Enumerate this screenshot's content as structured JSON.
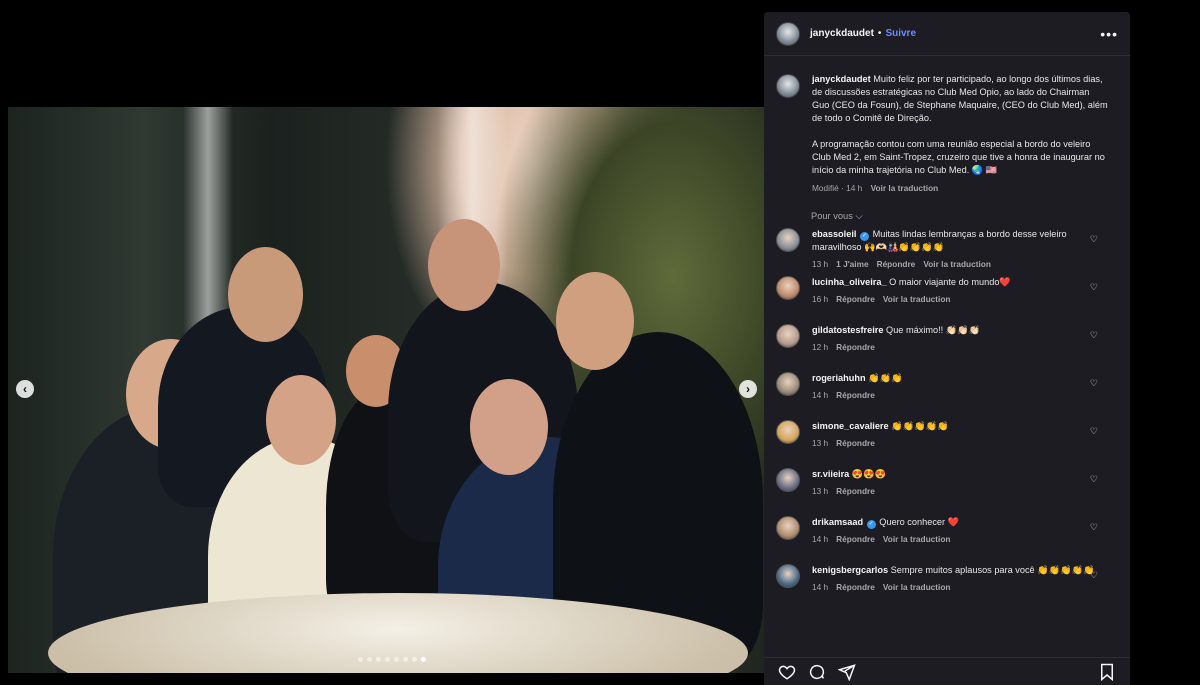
{
  "post": {
    "username": "janyckdaudet",
    "follow_label": "Suivre",
    "separator": "•",
    "more_label": "•••",
    "caption_p1": "Muito feliz por ter participado, ao longo dos últimos dias, de discussões estratégicas no Club Med Opio, ao lado do Chairman Guo (CEO da Fosun), de Stephane Maquaire, (CEO do Club Med), além de todo o Comitê de Direção.",
    "caption_p2": "A programação contou com uma reunião especial a bordo do veleiro Club Med 2, em Saint-Tropez, cruzeiro que tive a honra de inaugurar no início da minha trajetória no Club Med. 🌏 🇺🇸",
    "modified": "Modifié · 14 h",
    "see_translation": "Voir la traduction",
    "for_you": "Pour vous ⌵"
  },
  "carousel": {
    "prev": "‹",
    "next": "›",
    "slide_count": 8,
    "active_index": 7
  },
  "comments": [
    {
      "user": "ebassoleil",
      "verified": true,
      "text": "Muitas lindas lembranças a bordo desse veleiro maravilhoso 🙌🫶🏻🎎👏👏👏👏",
      "time": "13 h",
      "likes": "1 J'aime",
      "reply": "Répondre",
      "translate": "Voir la traduction",
      "avatar_color": "#8a8f98"
    },
    {
      "user": "lucinha_oliveira_",
      "verified": false,
      "text": "O maior viajante do mundo❤️",
      "time": "16 h",
      "likes": "",
      "reply": "Répondre",
      "translate": "Voir la traduction",
      "avatar_color": "#c08a6a"
    },
    {
      "user": "gildatostesfreire",
      "verified": false,
      "text": "Que máximo!! 👏🏻👏🏻👏🏻",
      "time": "12 h",
      "likes": "",
      "reply": "Répondre",
      "translate": "",
      "avatar_color": "#b79a8c"
    },
    {
      "user": "rogeriahuhn",
      "verified": false,
      "text": "👏👏👏",
      "time": "14 h",
      "likes": "",
      "reply": "Répondre",
      "translate": "",
      "avatar_color": "#9a8c7a"
    },
    {
      "user": "simone_cavaliere",
      "verified": false,
      "text": "👏👏👏👏👏",
      "time": "13 h",
      "likes": "",
      "reply": "Répondre",
      "translate": "",
      "avatar_color": "#d6a55a"
    },
    {
      "user": "sr.viieira",
      "verified": false,
      "text": "😍😍😍",
      "time": "13 h",
      "likes": "",
      "reply": "Répondre",
      "translate": "",
      "avatar_color": "#6a6e86"
    },
    {
      "user": "drikamsaad",
      "verified": true,
      "text": "Quero conhecer ❤️",
      "time": "14 h",
      "likes": "",
      "reply": "Répondre",
      "translate": "Voir la traduction",
      "avatar_color": "#b08d6e"
    },
    {
      "user": "kenigsbergcarlos",
      "verified": false,
      "text": "Sempre muitos aplausos para você 👏👏👏👏👏",
      "time": "14 h",
      "likes": "",
      "reply": "Répondre",
      "translate": "Voir la traduction",
      "avatar_color": "#4a6a8a"
    }
  ],
  "icons": {
    "like": "heart-icon",
    "comment": "comment-icon",
    "share": "share-icon",
    "save": "bookmark-icon"
  },
  "colors": {
    "accent": "#6b8cff",
    "panel_bg": "#1c1c22",
    "verified": "#3897f0"
  }
}
